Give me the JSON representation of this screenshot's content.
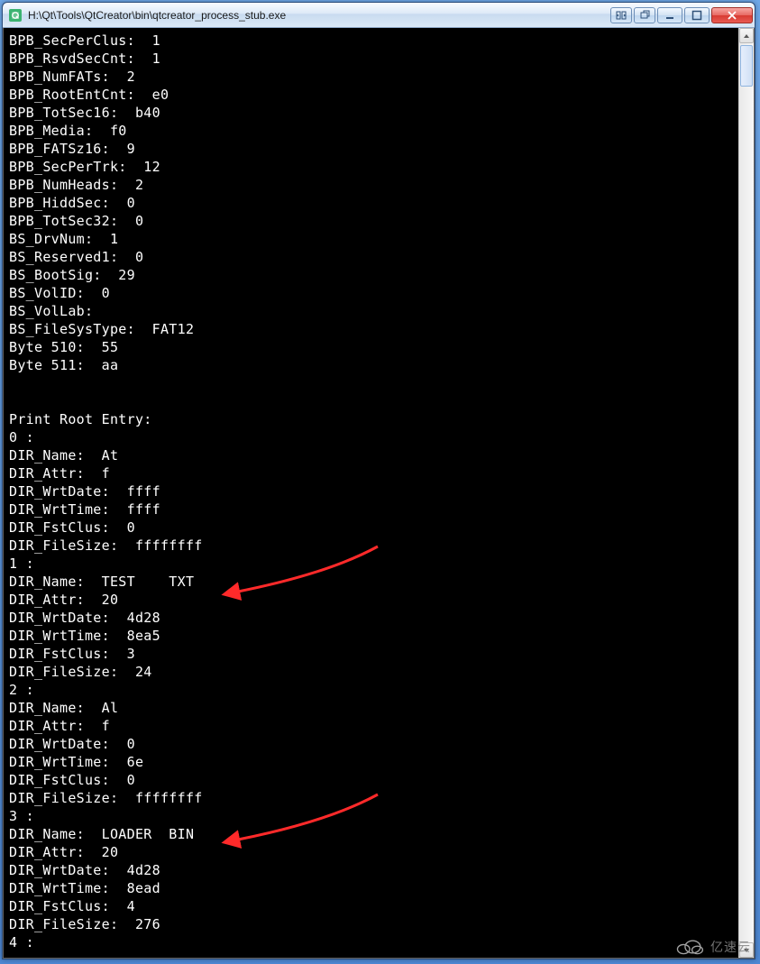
{
  "window": {
    "title": "H:\\Qt\\Tools\\QtCreator\\bin\\qtcreator_process_stub.exe",
    "icon_name": "qt-exe-icon"
  },
  "titlebar_buttons": {
    "extra1": "plain-layout-icon",
    "extra2": "pop-out-icon",
    "minimize": "minimize-icon",
    "maximize": "maximize-icon",
    "close": "close-icon"
  },
  "terminal_lines": [
    "BPB_SecPerClus:  1",
    "BPB_RsvdSecCnt:  1",
    "BPB_NumFATs:  2",
    "BPB_RootEntCnt:  e0",
    "BPB_TotSec16:  b40",
    "BPB_Media:  f0",
    "BPB_FATSz16:  9",
    "BPB_SecPerTrk:  12",
    "BPB_NumHeads:  2",
    "BPB_HiddSec:  0",
    "BPB_TotSec32:  0",
    "BS_DrvNum:  1",
    "BS_Reserved1:  0",
    "BS_BootSig:  29",
    "BS_VolID:  0",
    "BS_VolLab:",
    "BS_FileSysType:  FAT12",
    "Byte 510:  55",
    "Byte 511:  aa",
    "",
    "",
    "Print Root Entry:",
    "0 :",
    "DIR_Name:  At",
    "DIR_Attr:  f",
    "DIR_WrtDate:  ffff",
    "DIR_WrtTime:  ffff",
    "DIR_FstClus:  0",
    "DIR_FileSize:  ffffffff",
    "1 :",
    "DIR_Name:  TEST    TXT",
    "DIR_Attr:  20",
    "DIR_WrtDate:  4d28",
    "DIR_WrtTime:  8ea5",
    "DIR_FstClus:  3",
    "DIR_FileSize:  24",
    "2 :",
    "DIR_Name:  Al",
    "DIR_Attr:  f",
    "DIR_WrtDate:  0",
    "DIR_WrtTime:  6e",
    "DIR_FstClus:  0",
    "DIR_FileSize:  ffffffff",
    "3 :",
    "DIR_Name:  LOADER  BIN",
    "DIR_Attr:  20",
    "DIR_WrtDate:  4d28",
    "DIR_WrtTime:  8ead",
    "DIR_FstClus:  4",
    "DIR_FileSize:  276",
    "4 :"
  ],
  "annotations": {
    "arrow1_target": "DIR_Name:  TEST    TXT",
    "arrow2_target": "DIR_Name:  LOADER  BIN",
    "arrow_color": "#ff2a2a"
  },
  "watermark": {
    "text": "亿速云",
    "icon_name": "cloud-icon"
  }
}
